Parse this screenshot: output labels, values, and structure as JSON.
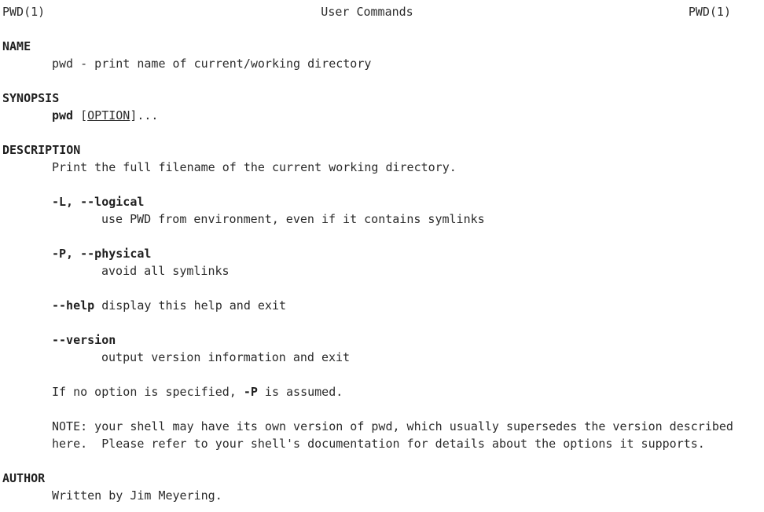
{
  "header": {
    "left": "PWD(1)",
    "center": "User Commands",
    "right": "PWD(1)"
  },
  "name": {
    "heading": "NAME",
    "text": "pwd - print name of current/working directory"
  },
  "synopsis": {
    "heading": "SYNOPSIS",
    "cmd": "pwd",
    "open": "[",
    "option": "OPTION",
    "close": "]..."
  },
  "description": {
    "heading": "DESCRIPTION",
    "intro": "Print the full filename of the current working directory.",
    "opt_L": {
      "name": "-L, --logical",
      "desc": "use PWD from environment, even if it contains symlinks"
    },
    "opt_P": {
      "name": "-P, --physical",
      "desc": "avoid all symlinks"
    },
    "opt_help": {
      "name": "--help",
      "desc": " display this help and exit"
    },
    "opt_version": {
      "name": "--version",
      "desc": "output version information and exit"
    },
    "default_pre": "If no option is specified, ",
    "default_opt": "-P",
    "default_post": " is assumed.",
    "note_line1": "NOTE: your shell may have its own version of pwd, which usually supersedes the version described",
    "note_line2": "here.  Please refer to your shell's documentation for details about the options it supports."
  },
  "author": {
    "heading": "AUTHOR",
    "text": "Written by Jim Meyering."
  }
}
